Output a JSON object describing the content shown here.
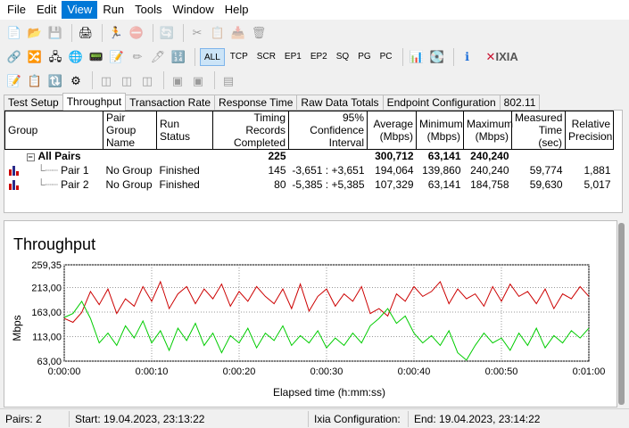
{
  "menu": {
    "items": [
      {
        "label": "File",
        "active": false
      },
      {
        "label": "Edit",
        "active": false
      },
      {
        "label": "View",
        "active": true
      },
      {
        "label": "Run",
        "active": false
      },
      {
        "label": "Tools",
        "active": false
      },
      {
        "label": "Window",
        "active": false
      },
      {
        "label": "Help",
        "active": false
      }
    ]
  },
  "toolbar": {
    "filters": [
      "ALL",
      "TCP",
      "SCR",
      "EP1",
      "EP2",
      "SQ",
      "PG",
      "PC"
    ],
    "active_filter": "ALL",
    "logo": "IXIA"
  },
  "tabs": [
    "Test Setup",
    "Throughput",
    "Transaction Rate",
    "Response Time",
    "Raw Data Totals",
    "Endpoint Configuration",
    "802.11"
  ],
  "active_tab": "Throughput",
  "table": {
    "columns": [
      "Group",
      "Pair Group Name",
      "Run Status",
      "Timing Records Completed",
      "95% Confidence Interval",
      "Average (Mbps)",
      "Minimum (Mbps)",
      "Maximum (Mbps)",
      "Measured Time (sec)",
      "Relative Precision"
    ],
    "summary": {
      "label": "All Pairs",
      "records": "225",
      "confidence": "",
      "average": "300,712",
      "minimum": "63,141",
      "maximum": "240,240"
    },
    "rows": [
      {
        "pair": "Pair 1",
        "group": "No Group",
        "status": "Finished",
        "records": "145",
        "confidence": "-3,651 : +3,651",
        "average": "194,064",
        "minimum": "139,860",
        "maximum": "240,240",
        "time": "59,774",
        "precision": "1,881"
      },
      {
        "pair": "Pair 2",
        "group": "No Group",
        "status": "Finished",
        "records": "80",
        "confidence": "-5,385 : +5,385",
        "average": "107,329",
        "minimum": "63,141",
        "maximum": "184,758",
        "time": "59,630",
        "precision": "5,017"
      }
    ]
  },
  "chart_data": {
    "type": "line",
    "title": "Throughput",
    "xlabel": "Elapsed time (h:mm:ss)",
    "ylabel": "Mbps",
    "xlim": [
      0,
      60
    ],
    "ylim": [
      63,
      259.35
    ],
    "xticks": [
      "0:00:00",
      "0:00:10",
      "0:00:20",
      "0:00:30",
      "0:00:40",
      "0:00:50",
      "0:01:00"
    ],
    "yticks": [
      "259,35",
      "213,00",
      "163,00",
      "113,00",
      "63,00"
    ],
    "grid": true,
    "series": [
      {
        "color": "#cc0000",
        "x": [
          0,
          1,
          2,
          3,
          4,
          5,
          6,
          7,
          8,
          9,
          10,
          11,
          12,
          13,
          14,
          15,
          16,
          17,
          18,
          19,
          20,
          21,
          22,
          23,
          24,
          25,
          26,
          27,
          28,
          29,
          30,
          31,
          32,
          33,
          34,
          35,
          36,
          37,
          38,
          39,
          40,
          41,
          42,
          43,
          44,
          45,
          46,
          47,
          48,
          49,
          50,
          51,
          52,
          53,
          54,
          55,
          56,
          57,
          58,
          59,
          60
        ],
        "values": [
          150,
          142,
          162,
          205,
          178,
          210,
          160,
          190,
          175,
          215,
          185,
          225,
          170,
          200,
          215,
          180,
          210,
          190,
          220,
          175,
          205,
          185,
          215,
          195,
          180,
          210,
          170,
          220,
          165,
          195,
          210,
          175,
          200,
          185,
          215,
          160,
          170,
          155,
          200,
          185,
          215,
          195,
          205,
          225,
          180,
          210,
          190,
          200,
          175,
          215,
          185,
          220,
          195,
          205,
          180,
          210,
          170,
          200,
          190,
          215,
          195
        ]
      },
      {
        "color": "#00cc00",
        "x": [
          0,
          1,
          2,
          3,
          4,
          5,
          6,
          7,
          8,
          9,
          10,
          11,
          12,
          13,
          14,
          15,
          16,
          17,
          18,
          19,
          20,
          21,
          22,
          23,
          24,
          25,
          26,
          27,
          28,
          29,
          30,
          31,
          32,
          33,
          34,
          35,
          36,
          37,
          38,
          39,
          40,
          41,
          42,
          43,
          44,
          45,
          46,
          47,
          48,
          49,
          50,
          51,
          52,
          53,
          54,
          55,
          56,
          57,
          58,
          59,
          60
        ],
        "values": [
          152,
          160,
          185,
          150,
          100,
          120,
          95,
          135,
          110,
          145,
          100,
          125,
          85,
          130,
          105,
          140,
          95,
          120,
          80,
          115,
          100,
          130,
          90,
          120,
          105,
          135,
          95,
          115,
          100,
          125,
          90,
          110,
          95,
          120,
          100,
          135,
          150,
          170,
          140,
          155,
          120,
          100,
          115,
          95,
          125,
          80,
          65,
          95,
          120,
          100,
          110,
          85,
          120,
          95,
          130,
          90,
          115,
          100,
          125,
          110,
          130
        ]
      }
    ]
  },
  "status": {
    "pairs": "Pairs: 2",
    "start": "Start: 19.04.2023, 23:13:22",
    "config": "Ixia Configuration:",
    "end": "End: 19.04.2023, 23:14:22"
  },
  "colors": {
    "menu_active": "#0078d7",
    "series1": "#cc0000",
    "series2": "#00cc00"
  }
}
